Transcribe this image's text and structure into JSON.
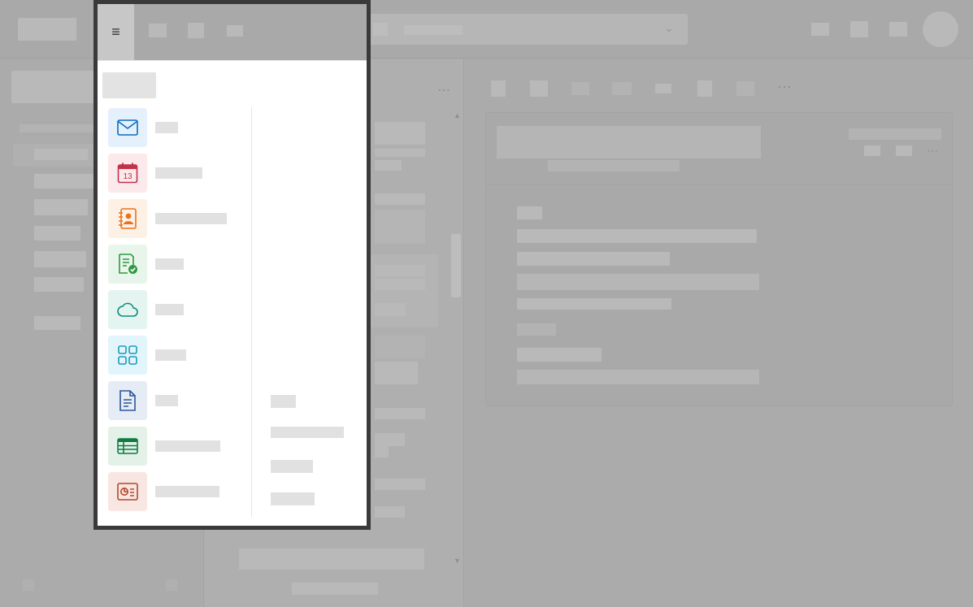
{
  "flyout": {
    "menu_glyph": "≡",
    "menu_icon": "hamburger-icon",
    "apps": [
      {
        "key": "mail",
        "icon": "mail-icon",
        "accent": "#0f6cbd",
        "bg": "#e4f0fb"
      },
      {
        "key": "calendar",
        "icon": "calendar-icon",
        "accent": "#c4314b",
        "bg": "#fbe9ec",
        "day": "13"
      },
      {
        "key": "people",
        "icon": "people-icon",
        "accent": "#e8731e",
        "bg": "#fdf0e4"
      },
      {
        "key": "todo",
        "icon": "todo-icon",
        "accent": "#2e9a42",
        "bg": "#e8f5ea"
      },
      {
        "key": "cloud",
        "icon": "cloud-icon",
        "accent": "#0f8b7a",
        "bg": "#e3f4f1"
      },
      {
        "key": "apps",
        "icon": "apps-grid-icon",
        "accent": "#1a9bbd",
        "bg": "#e2f5fa"
      },
      {
        "key": "word",
        "icon": "document-icon",
        "accent": "#2b579a",
        "bg": "#e6ecf6"
      },
      {
        "key": "excel",
        "icon": "spreadsheet-icon",
        "accent": "#107c41",
        "bg": "#e3f1e9"
      },
      {
        "key": "powerpoint",
        "icon": "presentation-icon",
        "accent": "#b7472a",
        "bg": "#f7e6e2"
      }
    ]
  },
  "colors": {
    "overlay": "#ababab",
    "flyout_border": "#3a3a3a",
    "skeleton": "#e1e1e1"
  }
}
